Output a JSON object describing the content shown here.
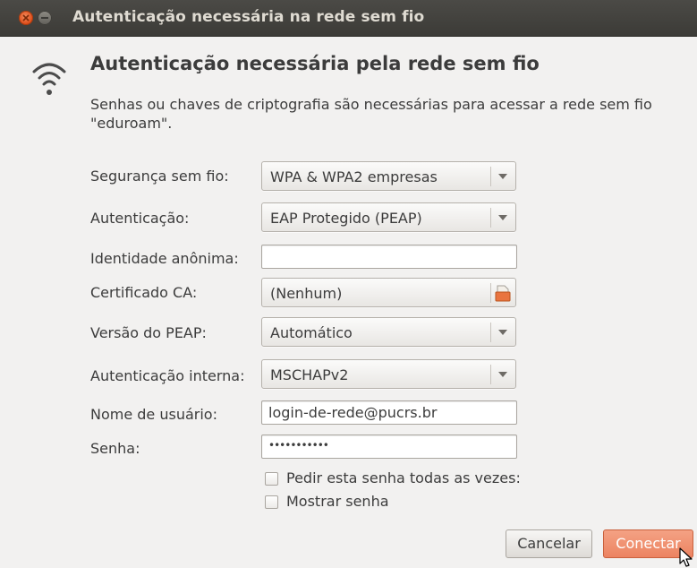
{
  "window": {
    "title": "Autenticação necessária na rede sem fio"
  },
  "dialog": {
    "heading": "Autenticação necessária pela rede sem fio",
    "description": "Senhas ou chaves de criptografia são necessárias para acessar a rede sem fio \"eduroam\"."
  },
  "form": {
    "wireless_security": {
      "label": "Segurança sem fio:",
      "value": "WPA & WPA2 empresas"
    },
    "authentication": {
      "label": "Autenticação:",
      "value": "EAP Protegido (PEAP)"
    },
    "anonymous_identity": {
      "label": "Identidade anônima:",
      "value": ""
    },
    "ca_certificate": {
      "label": "Certificado CA:",
      "value": "(Nenhum)"
    },
    "peap_version": {
      "label": "Versão do PEAP:",
      "value": "Automático"
    },
    "inner_authentication": {
      "label": "Autenticação interna:",
      "value": "MSCHAPv2"
    },
    "username": {
      "label": "Nome de usuário:",
      "value": "login-de-rede@pucrs.br"
    },
    "password": {
      "label": "Senha:",
      "value": "•••••••••••"
    },
    "ask_password_always": {
      "label": "Pedir esta senha todas as vezes:",
      "checked": false
    },
    "show_password": {
      "label": "Mostrar senha",
      "checked": false
    }
  },
  "buttons": {
    "cancel": "Cancelar",
    "connect": "Conectar"
  },
  "icons": {
    "close": "close-icon",
    "minimize": "minimize-icon",
    "wifi": "wifi-icon",
    "folder": "folder-icon",
    "dropdown": "chevron-down-icon",
    "cursor": "mouse-pointer-icon"
  },
  "colors": {
    "titlebar": "#3c3b37",
    "close_button": "#dd4814",
    "connect_button": "#ec8361",
    "background": "#f2f1f0"
  }
}
